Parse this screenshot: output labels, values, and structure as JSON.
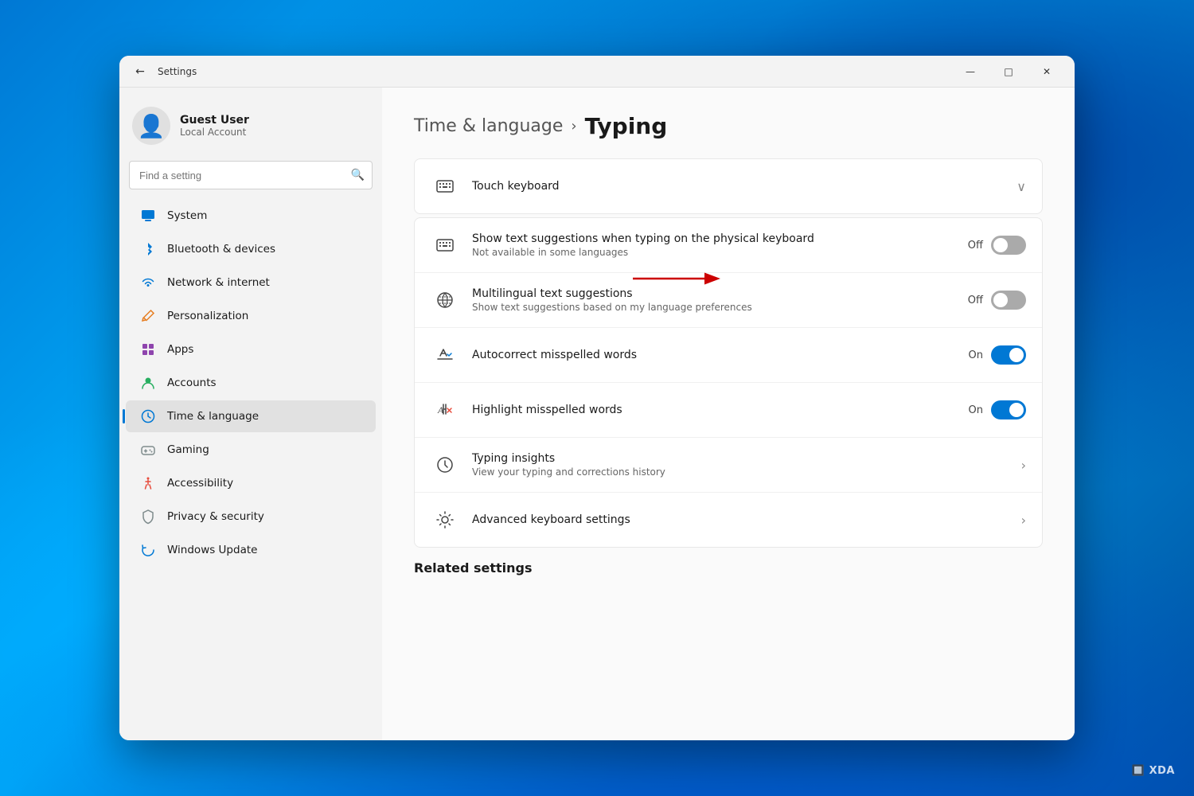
{
  "window": {
    "title": "Settings",
    "back_button": "←",
    "minimize": "—",
    "maximize": "□",
    "close": "✕"
  },
  "sidebar": {
    "user": {
      "name": "Guest User",
      "type": "Local Account"
    },
    "search_placeholder": "Find a setting",
    "nav_items": [
      {
        "id": "system",
        "label": "System",
        "icon": "🟦"
      },
      {
        "id": "bluetooth",
        "label": "Bluetooth & devices",
        "icon": "🔵"
      },
      {
        "id": "network",
        "label": "Network & internet",
        "icon": "📶"
      },
      {
        "id": "personalization",
        "label": "Personalization",
        "icon": "✏️"
      },
      {
        "id": "apps",
        "label": "Apps",
        "icon": "📦"
      },
      {
        "id": "accounts",
        "label": "Accounts",
        "icon": "👤"
      },
      {
        "id": "time",
        "label": "Time & language",
        "icon": "🌐",
        "active": true
      },
      {
        "id": "gaming",
        "label": "Gaming",
        "icon": "🎮"
      },
      {
        "id": "accessibility",
        "label": "Accessibility",
        "icon": "♿"
      },
      {
        "id": "privacy",
        "label": "Privacy & security",
        "icon": "🛡️"
      },
      {
        "id": "update",
        "label": "Windows Update",
        "icon": "🔄"
      }
    ]
  },
  "content": {
    "breadcrumb_parent": "Time & language",
    "breadcrumb_chevron": "›",
    "breadcrumb_current": "Typing",
    "sections": [
      {
        "id": "touch-keyboard",
        "icon": "⌨",
        "title": "Touch keyboard",
        "type": "expandable",
        "expanded": true
      }
    ],
    "settings_items": [
      {
        "id": "text-suggestions-physical",
        "icon": "⌨",
        "title": "Show text suggestions when typing on the physical keyboard",
        "subtitle": "Not available in some languages",
        "control_type": "toggle",
        "toggle_state": "off",
        "toggle_label": "Off"
      },
      {
        "id": "multilingual-suggestions",
        "icon": "🌐",
        "title": "Multilingual text suggestions",
        "subtitle": "Show text suggestions based on my language preferences",
        "control_type": "toggle",
        "toggle_state": "off",
        "toggle_label": "Off"
      },
      {
        "id": "autocorrect",
        "icon": "✍",
        "title": "Autocorrect misspelled words",
        "subtitle": "",
        "control_type": "toggle",
        "toggle_state": "on",
        "toggle_label": "On"
      },
      {
        "id": "highlight-misspelled",
        "icon": "🔤",
        "title": "Highlight misspelled words",
        "subtitle": "",
        "control_type": "toggle",
        "toggle_state": "on",
        "toggle_label": "On"
      },
      {
        "id": "typing-insights",
        "icon": "🕐",
        "title": "Typing insights",
        "subtitle": "View your typing and corrections history",
        "control_type": "chevron"
      },
      {
        "id": "advanced-keyboard",
        "icon": "⚙",
        "title": "Advanced keyboard settings",
        "subtitle": "",
        "control_type": "chevron"
      }
    ],
    "related_settings_label": "Related settings"
  }
}
